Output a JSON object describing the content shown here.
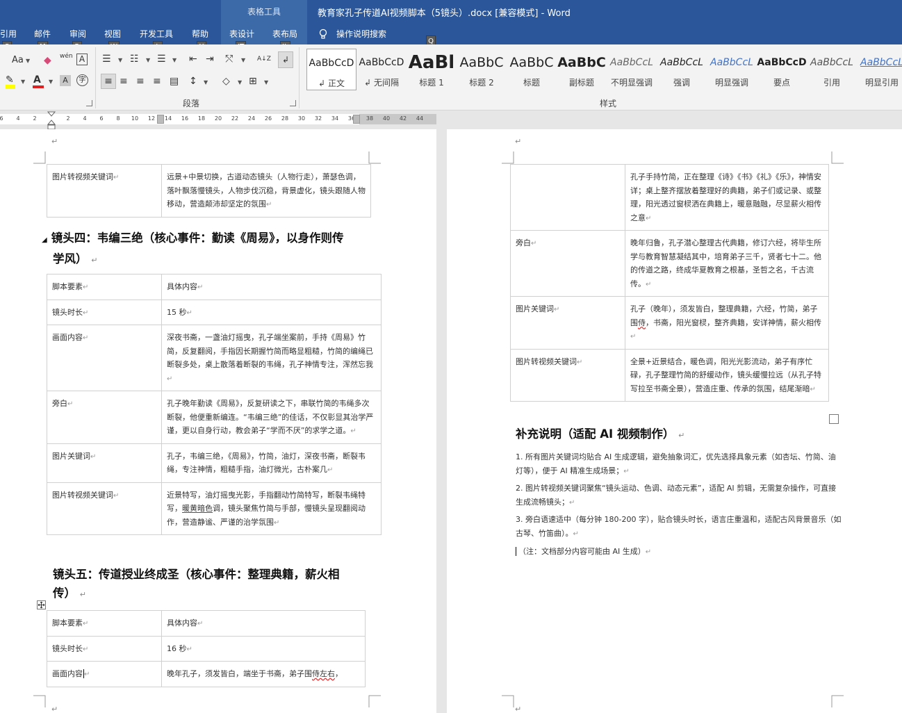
{
  "window": {
    "title": "教育家孔子传道AI视频脚本（5镜头）.docx [兼容模式] - Word",
    "context_group": "表格工具",
    "tell_me": "操作说明搜索"
  },
  "tabs": [
    "引用",
    "邮件",
    "审阅",
    "视图",
    "开发工具",
    "帮助",
    "表设计",
    "表布局"
  ],
  "keytips": [
    "S",
    "M",
    "R",
    "W",
    "L",
    "Y",
    "JT",
    "JL",
    "Q"
  ],
  "ribbon": {
    "font_group": {
      "change_case": "Aa",
      "char_border": "A",
      "enclose_char": "字",
      "phonetic": "wén"
    },
    "paragraph_group": {
      "label": "段落",
      "sort": "A↓Z"
    },
    "styles_group": {
      "label": "样式",
      "styles": [
        {
          "sample": "AaBbCcD",
          "name": "正文",
          "prefix": "↲"
        },
        {
          "sample": "AaBbCcD",
          "name": "无间隔",
          "prefix": "↲"
        },
        {
          "sample": "AaBl",
          "name": "标题 1"
        },
        {
          "sample": "AaBbC",
          "name": "标题 2"
        },
        {
          "sample": "AaBbC",
          "name": "标题"
        },
        {
          "sample": "AaBbC",
          "name": "副标题"
        },
        {
          "sample": "AaBbCcL",
          "name": "不明显强调"
        },
        {
          "sample": "AaBbCcL",
          "name": "强调"
        },
        {
          "sample": "AaBbCcL",
          "name": "明显强调"
        },
        {
          "sample": "AaBbCcD",
          "name": "要点"
        },
        {
          "sample": "AaBbCcL",
          "name": "引用"
        },
        {
          "sample": "AaBbCcL",
          "name": "明显引用"
        }
      ]
    }
  },
  "ruler": {
    "ticks": [
      "6",
      "4",
      "2",
      "2",
      "4",
      "6",
      "8",
      "10",
      "12",
      "14",
      "16",
      "18",
      "20",
      "22",
      "24",
      "26",
      "28",
      "30",
      "32",
      "34",
      "36",
      "38",
      "40",
      "42",
      "44"
    ]
  },
  "doc": {
    "para_mark": "↵",
    "left_top_table": {
      "key": "图片转视频关键词",
      "value": "远景+中景切换，古道动态镜头（人物行走），萧瑟色调，落叶飘落慢镜头，人物步伐沉稳，背景虚化，镜头跟随人物移动，营造颠沛却坚定的氛围"
    },
    "shot4": {
      "heading_line1": "镜头四：韦编三绝（核心事件：勤读《周易》，以身作则传",
      "heading_line2": "学风）",
      "rows": [
        {
          "key": "脚本要素",
          "value": "具体内容"
        },
        {
          "key": "镜头时长",
          "value": "15 秒"
        },
        {
          "key": "画面内容",
          "value": "深夜书斋，一盏油灯摇曳，孔子端坐案前，手持《周易》竹简，反复翻阅，手指因长期握竹简而略显粗糙，竹简的编绳已断裂多处，桌上散落着断裂的韦绳，孔子神情专注，浑然忘我"
        },
        {
          "key": "旁白",
          "value": "孔子晚年勤读《周易》，反复研读之下，串联竹简的韦绳多次断裂，他便重新编连。“韦编三绝”的佳话，不仅彰显其治学严谨，更以自身行动，教会弟子“学而不厌”的求学之道。"
        },
        {
          "key": "图片关键词",
          "value": "孔子，韦编三绝，《周易》，竹简，油灯，深夜书斋，断裂韦绳，专注神情，粗糙手指，油灯微光，古朴案几"
        },
        {
          "key": "图片转视频关键词",
          "value_a": "近景特写，油灯摇曳光影，手指翻动竹简特写，断裂韦绳特写，",
          "value_b": "暖黄暗色",
          "value_c": "调，镜头聚焦竹简与手部，慢镜头呈现翻阅动作，营造静谧、严谨的治学氛围"
        }
      ]
    },
    "shot5": {
      "heading_line1": "镜头五：传道授业终成圣（核心事件：整理典籍，薪火相",
      "heading_line2": "传）",
      "rows": [
        {
          "key": "脚本要素",
          "value": "具体内容"
        },
        {
          "key": "镜头时长",
          "value": "16 秒"
        },
        {
          "key": "画面内容",
          "value_a": "晚年孔子，须发皆白，端坐于书斋，弟子围",
          "value_b": "侍左右",
          "value_c": "，"
        }
      ]
    },
    "right_table": {
      "continued": "孔子手持竹简，正在整理《诗》《书》《礼》《乐》，神情安详；桌上整齐摆放着整理好的典籍，弟子们或记录、或整理，阳光透过窗棂洒在典籍上，暖意融融，尽显薪火相传之意",
      "rows": [
        {
          "key": "旁白",
          "value": "晚年归鲁，孔子潜心整理古代典籍，修订六经，将毕生所学与教育智慧凝结其中，培育弟子三千，贤者七十二。他的传道之路，终成华夏教育之根基，圣哲之名，千古流传。"
        },
        {
          "key": "图片关键词",
          "value_a": "孔子（晚年），须发皆白，整理典籍，六经，竹简，弟子围",
          "value_b": "侍",
          "value_c": "，书斋，阳光窗棂，整齐典籍，安详神情，薪火相传"
        },
        {
          "key": "图片转视频关键词",
          "value": "全景+近景结合，暖色调，阳光光影流动，弟子有序忙碌，孔子整理竹简的舒缓动作，镜头缓慢拉远（从孔子特写拉至书斋全景），营造庄重、传承的氛围，结尾渐暗"
        }
      ]
    },
    "supplement": {
      "heading": "补充说明（适配 AI 视频制作）",
      "items": [
        "1. 所有图片关键词均贴合 AI 生成逻辑，避免抽象词汇，优先选择具象元素（如杏坛、竹简、油灯等），便于 AI 精准生成场景；",
        "2. 图片转视频关键词聚焦“镜头运动、色调、动态元素”，适配 AI 剪辑，无需复杂操作，可直接生成流畅镜头；",
        "3. 旁白语速适中（每分钟 180-200 字），贴合镜头时长，语言庄重温和，适配古风背景音乐（如古琴、竹笛曲）。"
      ],
      "footnote": "（注：文档部分内容可能由 AI 生成）"
    }
  }
}
